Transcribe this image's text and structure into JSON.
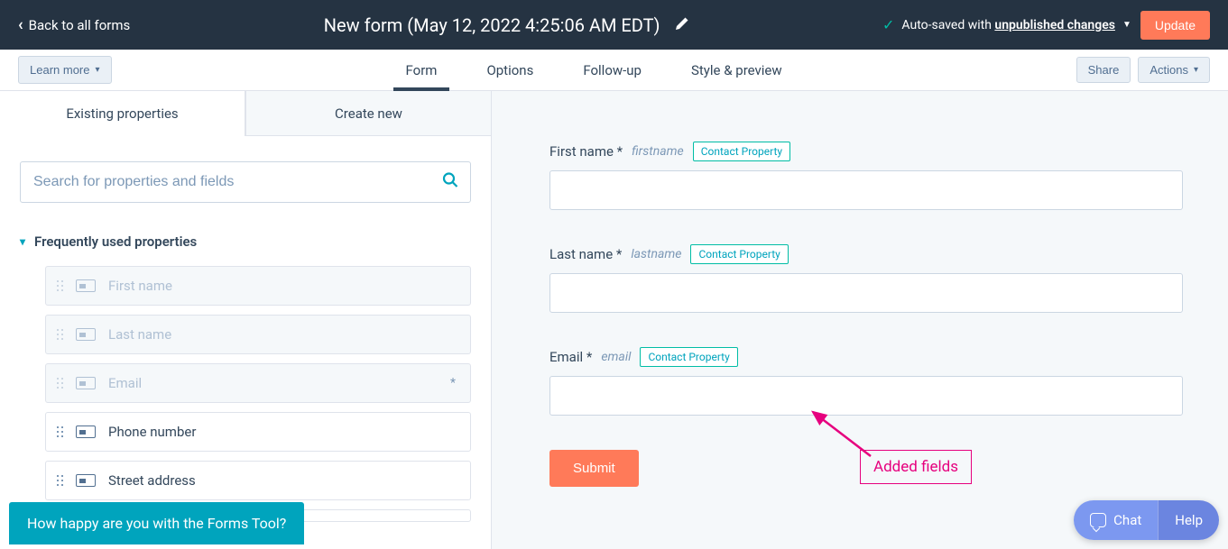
{
  "topbar": {
    "back_label": "Back to all forms",
    "title": "New form (May 12, 2022 4:25:06 AM EDT)",
    "autosave_prefix": "Auto-saved with ",
    "autosave_link": "unpublished changes",
    "update_label": "Update"
  },
  "secondbar": {
    "learn_more": "Learn more",
    "tabs": [
      {
        "label": "Form",
        "active": true
      },
      {
        "label": "Options",
        "active": false
      },
      {
        "label": "Follow-up",
        "active": false
      },
      {
        "label": "Style & preview",
        "active": false
      }
    ],
    "share": "Share",
    "actions": "Actions"
  },
  "left": {
    "tabs": [
      {
        "label": "Existing properties",
        "active": true
      },
      {
        "label": "Create new",
        "active": false
      }
    ],
    "search_placeholder": "Search for properties and fields",
    "section_header": "Frequently used properties",
    "items": [
      {
        "label": "First name",
        "disabled": true,
        "required": false
      },
      {
        "label": "Last name",
        "disabled": true,
        "required": false
      },
      {
        "label": "Email",
        "disabled": true,
        "required": true
      },
      {
        "label": "Phone number",
        "disabled": false,
        "required": false
      },
      {
        "label": "Street address",
        "disabled": false,
        "required": false
      }
    ]
  },
  "preview": {
    "fields": [
      {
        "label": "First name *",
        "internal": "firstname",
        "tag": "Contact Property"
      },
      {
        "label": "Last name *",
        "internal": "lastname",
        "tag": "Contact Property"
      },
      {
        "label": "Email *",
        "internal": "email",
        "tag": "Contact Property"
      }
    ],
    "submit": "Submit",
    "annotation": "Added fields"
  },
  "survey": "How happy are you with the Forms Tool?",
  "chat": {
    "chat": "Chat",
    "help": "Help"
  }
}
